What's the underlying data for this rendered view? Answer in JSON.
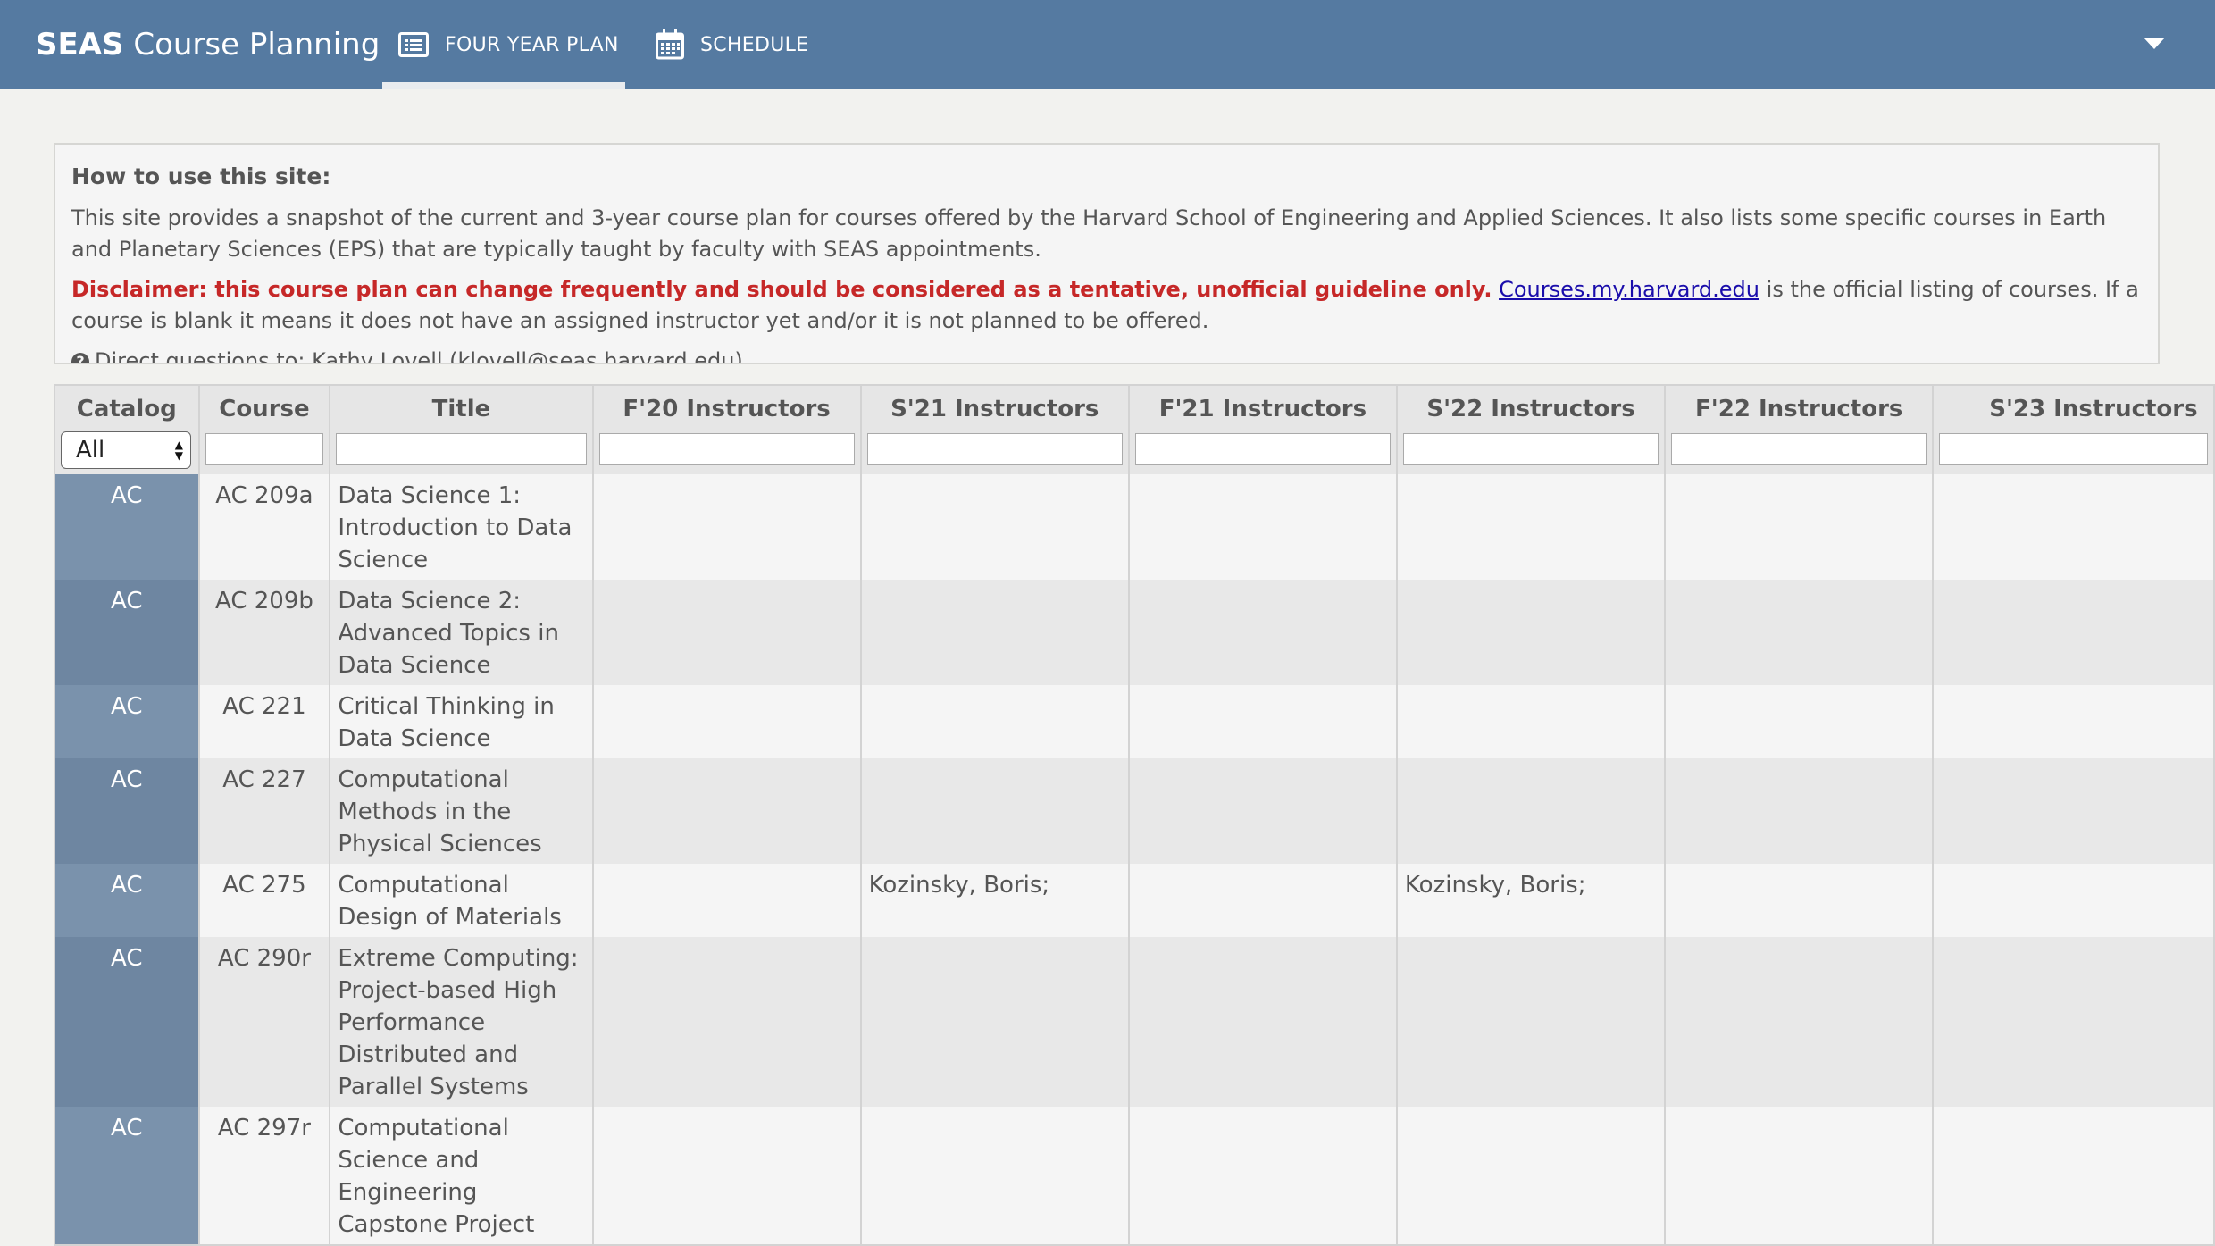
{
  "nav": {
    "brand_bold": "SEAS",
    "brand_rest": " Course Planning",
    "tabs": [
      {
        "label": "FOUR YEAR PLAN",
        "icon": "list-icon",
        "active": true
      },
      {
        "label": "SCHEDULE",
        "icon": "calendar-icon",
        "active": false
      }
    ],
    "menu_icon": "caret-down-icon"
  },
  "info": {
    "heading": "How to use this site:",
    "intro": "This site provides a snapshot of the current and 3-year course plan for courses offered by the Harvard School of Engineering and Applied Sciences. It also lists some specific courses in Earth and Planetary Sciences (EPS) that are typically taught by faculty with SEAS appointments.",
    "disclaimer": "Disclaimer: this course plan can change frequently and should be considered as a tentative, unofficial guideline only.",
    "link_text": "Courses.my.harvard.edu",
    "after_link": " is the official listing of courses. If a course is blank it means it does not have an assigned instructor yet and/or it is not planned to be offered.",
    "questions": "Direct questions to: Kathy Lovell (klovell@seas.harvard.edu)"
  },
  "table": {
    "columns": [
      "Catalog",
      "Course",
      "Title",
      "F'20 Instructors",
      "S'21 Instructors",
      "F'21 Instructors",
      "S'22 Instructors",
      "F'22 Instructors",
      "S'23 Instructors"
    ],
    "catalog_filter": "All",
    "rows": [
      {
        "catalog": "AC",
        "course": "AC 209a",
        "title": "Data Science 1: Introduction to Data Science",
        "f20": "",
        "s21": "",
        "f21": "",
        "s22": "",
        "f22": "",
        "s23": ""
      },
      {
        "catalog": "AC",
        "course": "AC 209b",
        "title": "Data Science 2: Advanced Topics in Data Science",
        "f20": "",
        "s21": "",
        "f21": "",
        "s22": "",
        "f22": "",
        "s23": ""
      },
      {
        "catalog": "AC",
        "course": "AC 221",
        "title": "Critical Thinking in Data Science",
        "f20": "",
        "s21": "",
        "f21": "",
        "s22": "",
        "f22": "",
        "s23": ""
      },
      {
        "catalog": "AC",
        "course": "AC 227",
        "title": "Computational Methods in the Physical Sciences",
        "f20": "",
        "s21": "",
        "f21": "",
        "s22": "",
        "f22": "",
        "s23": ""
      },
      {
        "catalog": "AC",
        "course": "AC 275",
        "title": "Computational Design of Materials",
        "f20": "",
        "s21": "Kozinsky, Boris;",
        "f21": "",
        "s22": "Kozinsky, Boris;",
        "f22": "",
        "s23": ""
      },
      {
        "catalog": "AC",
        "course": "AC 290r",
        "title": "Extreme Computing: Project-based High Performance Distributed and Parallel Systems",
        "f20": "",
        "s21": "",
        "f21": "",
        "s22": "",
        "f22": "",
        "s23": ""
      },
      {
        "catalog": "AC",
        "course": "AC 297r",
        "title": "Computational Science and Engineering Capstone Project",
        "f20": "",
        "s21": "",
        "f21": "",
        "s22": "",
        "f22": "",
        "s23": ""
      }
    ]
  }
}
